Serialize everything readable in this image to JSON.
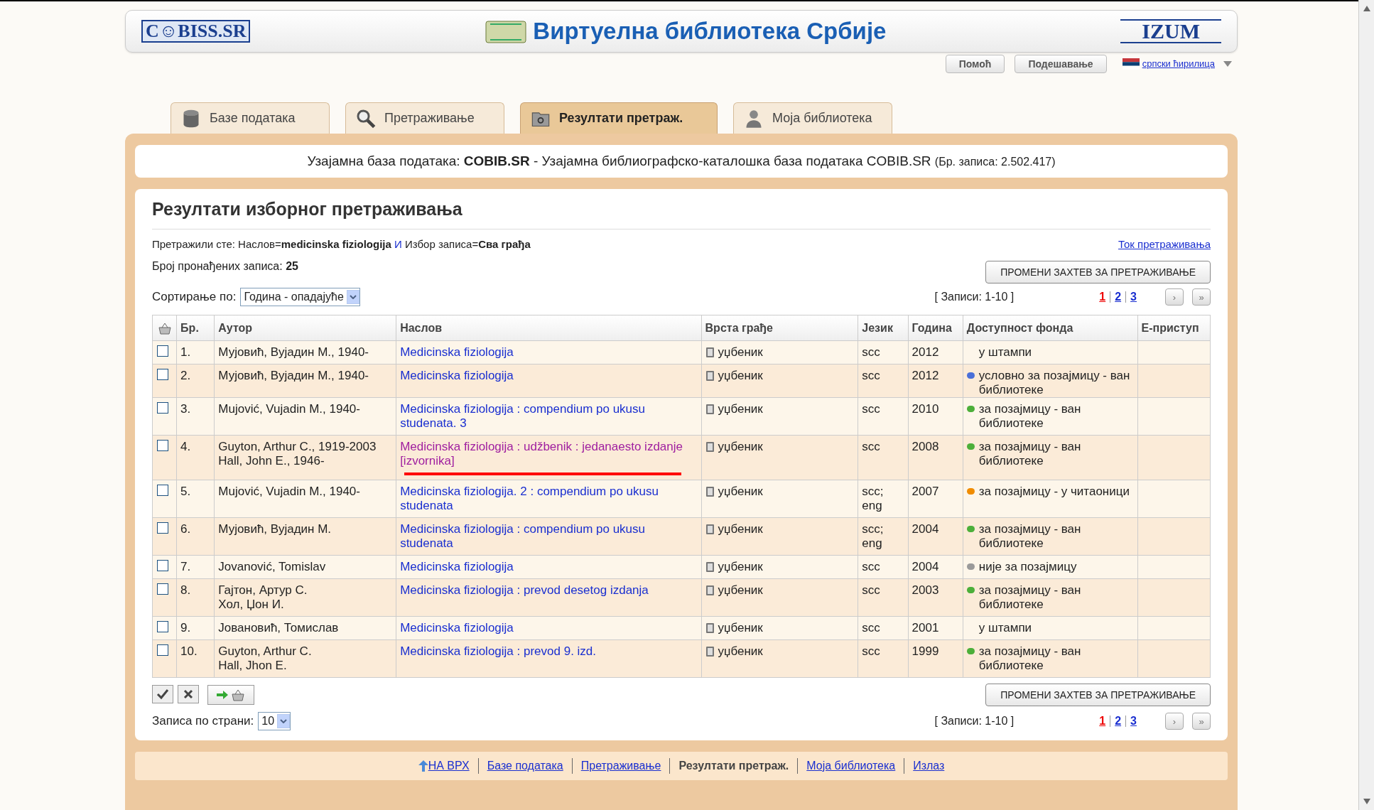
{
  "header": {
    "logo_left": "C☺BISS.SR",
    "site_title": "Виртуелна библиотека Србије",
    "logo_right": "IZUM"
  },
  "top_buttons": [
    "Помоћ",
    "Подешавање"
  ],
  "language": {
    "label": "српски ћирилица"
  },
  "tabs": [
    {
      "label": "Базе података",
      "selected": false,
      "kind": "database"
    },
    {
      "label": "Претраживање",
      "selected": false,
      "kind": "search"
    },
    {
      "label": "Резултати претраж.",
      "selected": true,
      "kind": "results"
    },
    {
      "label": "Моја библиотека",
      "selected": false,
      "kind": "user"
    }
  ],
  "database_info": {
    "prefix": "Узајамна база података: ",
    "name": "COBIB.SR",
    "description": " - Узајамна библиографско-каталошка база података COBIB.SR",
    "count": "(Бр. записа: 2.502.417)"
  },
  "results": {
    "title": "Резултати изборног претраживања",
    "query": "Претражили сте: Наслов=**medicinska fiziologija**",
    "query_operator": "И",
    "query_rest": "Избор записа=**Сва грађа**",
    "history_link": "Ток претраживања",
    "found_label": "Број пронађених записа: ",
    "found_count": "25",
    "change_buttons": [
      "ПРОМЕНИ ЗАХТЕВ ЗА ПРЕТРАЖИВАЊЕ",
      "ПРОМЕНИ ЗАХТЕВ ЗА ПРЕТРАЖИВАЊЕ"
    ],
    "sort_label": "Сортирање по:",
    "sort_value": "Година - опадајуће",
    "pagers": [
      {
        "records_range": "[ Записи: 1-10 ]",
        "pages": [
          {
            "label": "1",
            "selected": true
          },
          {
            "label": "2",
            "selected": false
          },
          {
            "label": "3",
            "selected": false
          }
        ],
        "next": "›",
        "last": "»"
      },
      {
        "records_range": "[ Записи: 1-10 ]",
        "pages": [
          {
            "label": "1",
            "selected": true
          },
          {
            "label": "2",
            "selected": false
          },
          {
            "label": "3",
            "selected": false
          }
        ],
        "next": "›",
        "last": "»"
      }
    ],
    "columns": [
      "Бр.",
      "Аутор",
      "Наслов",
      "Врста грађе",
      "Језик",
      "Година",
      "Доступност фонда",
      "Е-приступ"
    ],
    "rows": [
      {
        "checked": false,
        "no": "1.",
        "authors": [
          "Мујовић, Вујадин М., 1940-"
        ],
        "title": "Medicinska fiziologija",
        "visited": false,
        "marked": false,
        "type": "уџбеник",
        "language": [
          "scc"
        ],
        "year": "2012",
        "availability": "у штампи"
      },
      {
        "checked": false,
        "no": "2.",
        "authors": [
          "Мујовић, Вујадин М., 1940-"
        ],
        "title": "Medicinska fiziologija",
        "visited": false,
        "marked": false,
        "type": "уџбеник",
        "language": [
          "scc"
        ],
        "year": "2012",
        "availability": "условно за позајмицу - ван библиотеке",
        "color": "#4a6fd8"
      },
      {
        "checked": false,
        "no": "3.",
        "authors": [
          "Mujović, Vujadin M., 1940-"
        ],
        "title": "Medicinska fiziologija : compendium po ukusu studenata. 3",
        "visited": false,
        "marked": false,
        "type": "уџбеник",
        "language": [
          "scc"
        ],
        "year": "2010",
        "availability": "за позајмицу - ван библиотеке",
        "color": "#4caf3a"
      },
      {
        "checked": false,
        "no": "4.",
        "authors": [
          "Guyton, Arthur C., 1919-2003",
          "Hall, John E., 1946-"
        ],
        "title": "Medicinska fiziologija : udžbenik : jedanaesto izdanje [izvornika]",
        "visited": true,
        "marked": true,
        "type": "уџбеник",
        "language": [
          "scc"
        ],
        "year": "2008",
        "availability": "за позајмицу - ван библиотеке",
        "color": "#4caf3a"
      },
      {
        "checked": false,
        "no": "5.",
        "authors": [
          "Mujović, Vujadin M., 1940-"
        ],
        "title": "Medicinska fiziologija. 2 : compendium po ukusu studenata",
        "visited": false,
        "marked": false,
        "type": "уџбеник",
        "language": [
          "scc;",
          "eng"
        ],
        "year": "2007",
        "availability": "за позајмицу - у читаоници",
        "color": "#f08c00"
      },
      {
        "checked": false,
        "no": "6.",
        "authors": [
          "Мујовић, Вујадин М."
        ],
        "title": "Medicinska fiziologija : compendium po ukusu studenata",
        "visited": false,
        "marked": false,
        "type": "уџбеник",
        "language": [
          "scc;",
          "eng"
        ],
        "year": "2004",
        "availability": "за позајмицу - ван библиотеке",
        "color": "#4caf3a"
      },
      {
        "checked": false,
        "no": "7.",
        "authors": [
          "Jovanović, Tomislav"
        ],
        "title": "Medicinska fiziologija",
        "visited": false,
        "marked": false,
        "type": "уџбеник",
        "language": [
          "scc"
        ],
        "year": "2004",
        "availability": "није за позајмицу",
        "color": "#9a9a9a"
      },
      {
        "checked": false,
        "no": "8.",
        "authors": [
          "Гајтон, Артур С.",
          "Хол, Џон И."
        ],
        "title": "Medicinska fiziologija : prevod desetog izdanja",
        "visited": false,
        "marked": false,
        "type": "уџбеник",
        "language": [
          "scc"
        ],
        "year": "2003",
        "availability": "за позајмицу - ван библиотеке",
        "color": "#4caf3a"
      },
      {
        "checked": false,
        "no": "9.",
        "authors": [
          "Јовановић, Томислав"
        ],
        "title": "Medicinska fiziologija",
        "visited": false,
        "marked": false,
        "type": "уџбеник",
        "language": [
          "scc"
        ],
        "year": "2001",
        "availability": "у штампи"
      },
      {
        "checked": false,
        "no": "10.",
        "authors": [
          "Guyton, Arthur C.",
          "Hall, Jhon E."
        ],
        "title": "Medicinska fiziologija : prevod 9. izd.",
        "visited": false,
        "marked": false,
        "type": "уџбеник",
        "language": [
          "scc"
        ],
        "year": "1999",
        "availability": "за позајмицу - ван библиотеке",
        "color": "#4caf3a"
      }
    ],
    "per_page_label": "Записа по страни:",
    "per_page_value": "10"
  },
  "footer": [
    {
      "label": "НА ВРХ",
      "kind": "top",
      "current": false
    },
    {
      "label": "Базе података",
      "kind": "link",
      "current": false
    },
    {
      "label": "Претраживање",
      "kind": "link",
      "current": false
    },
    {
      "label": "Резултати претраж.",
      "kind": "link",
      "current": true
    },
    {
      "label": "Моја библиотека",
      "kind": "link",
      "current": false
    },
    {
      "label": "Излаз",
      "kind": "link",
      "current": false
    }
  ]
}
